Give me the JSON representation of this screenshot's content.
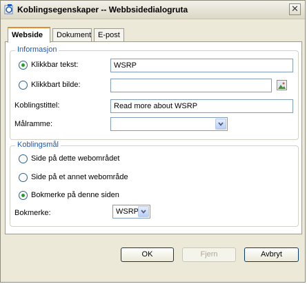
{
  "window": {
    "title": "Koblingsegenskaper -- Webbsidedialogruta",
    "close_glyph": "✕"
  },
  "tabs": [
    {
      "label": "Webside",
      "active": true
    },
    {
      "label": "Dokument",
      "active": false
    },
    {
      "label": "E-post",
      "active": false
    }
  ],
  "info": {
    "legend": "Informasjon",
    "clickable_text": {
      "label": "Klikkbar tekst:",
      "value": "WSRP",
      "selected": true
    },
    "clickable_image": {
      "label": "Klikkbart bilde:",
      "value": "",
      "selected": false
    },
    "link_title": {
      "label": "Koblingstittel:",
      "value": "Read more about WSRP"
    },
    "target_frame": {
      "label": "Målramme:",
      "value": ""
    }
  },
  "target": {
    "legend": "Koblingsmål",
    "options": [
      {
        "label": "Side på dette webområdet",
        "selected": false
      },
      {
        "label": "Side på et annet webområde",
        "selected": false
      },
      {
        "label": "Bokmerke på denne siden",
        "selected": true
      }
    ],
    "bookmark": {
      "label": "Bokmerke:",
      "value": "WSRP"
    }
  },
  "buttons": {
    "ok": "OK",
    "remove": "Fjern",
    "cancel": "Avbryt"
  },
  "colors": {
    "accent_tab": "#e68b2c",
    "legend": "#1f56b8",
    "radio_dot": "#21a121"
  },
  "icons": [
    "window-app-icon",
    "close-icon",
    "image-browse-icon",
    "chevron-down-icon"
  ]
}
